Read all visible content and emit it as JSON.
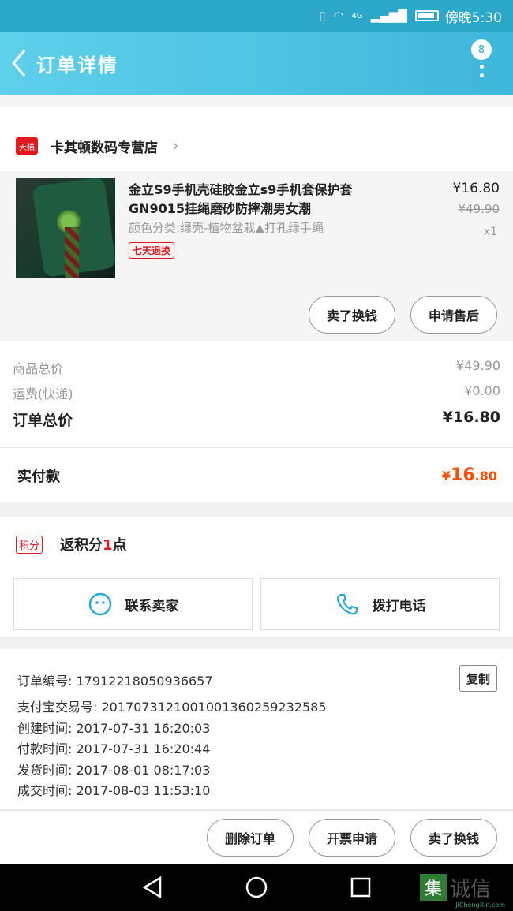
{
  "status_bar": {
    "time": "傍晚5:30",
    "network": "4G"
  },
  "header": {
    "title": "订单详情",
    "badge": "8"
  },
  "shop": {
    "platform": "天猫",
    "name": "卡其顿数码专营店"
  },
  "product": {
    "title": "金立S9手机壳硅胶金立s9手机套保护套GN9015挂绳磨砂防摔潮男女潮",
    "sku": "颜色分类:绿壳-植物盆栽▲打孔绿手绳",
    "tag": "七天退换",
    "price": "¥16.80",
    "original_price": "¥49.90",
    "quantity": "x1",
    "buttons": {
      "refund": "卖了换钱",
      "after_sale": "申请售后"
    }
  },
  "totals": {
    "goods_label": "商品总价",
    "goods_value": "¥49.90",
    "shipping_label": "运费(快递)",
    "shipping_value": "¥0.00",
    "order_label": "订单总价",
    "order_value": "¥16.80",
    "paid_label": "实付款",
    "paid_symbol": "¥",
    "paid_int": "16",
    "paid_dec": ".80"
  },
  "points": {
    "tag": "积分",
    "text_pre": "返积分",
    "value": "1",
    "text_post": "点"
  },
  "contact": {
    "seller": "联系卖家",
    "phone": "拨打电话"
  },
  "order_info": {
    "copy_label": "复制",
    "lines": [
      "订单编号: 17912218050936657",
      "支付宝交易号: 2017073121001001360259232585",
      "创建时间: 2017-07-31 16:20:03",
      "付款时间: 2017-07-31 16:20:44",
      "发货时间: 2017-08-01 08:17:03",
      "成交时间: 2017-08-03 11:53:10"
    ]
  },
  "footer": {
    "delete": "删除订单",
    "invoice": "开票申请",
    "resell": "卖了换钱"
  },
  "watermark": {
    "mark": "集",
    "text": "诚信",
    "url": "JiChengXin.com"
  },
  "colors": {
    "accent": "#3fb7dc",
    "price_orange": "#ff5000",
    "tmall_red": "#e4161e"
  }
}
